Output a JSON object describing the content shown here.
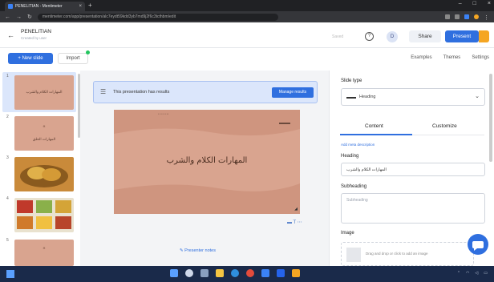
{
  "browser": {
    "tab_title": "PENELITIAN - Mentimeter",
    "url": "mentimeter.com/app/presentation/alc7eydt59kdd3yb7md9j2f6c3tcthbm/edit"
  },
  "header": {
    "title": "PENELITIAN",
    "subtitle": "Created by user",
    "saved_label": "Saved",
    "help_icon": "question-icon",
    "avatar_initials": "D",
    "share_label": "Share",
    "present_label": "Present"
  },
  "toolbar": {
    "new_slide_label": "+ New slide",
    "import_label": "Import",
    "examples_label": "Examples",
    "themes_label": "Themes",
    "settings_label": "Settings"
  },
  "thumbnails": [
    {
      "number": "1",
      "label": "المهارات الكلام والشرب",
      "bg": "#d9a48f"
    },
    {
      "number": "2",
      "label": "المهارات الحلق",
      "bg": "#d9a48f"
    },
    {
      "number": "3",
      "label": "",
      "bg": "#c98a3a"
    },
    {
      "number": "4",
      "label": "",
      "bg": "#e9e2cf"
    },
    {
      "number": "5",
      "label": "",
      "bg": "#d9a48f"
    }
  ],
  "banner": {
    "text": "This presentation has results",
    "button_label": "Manage results"
  },
  "slide": {
    "title": "المهارات الكلام والشرب"
  },
  "presenter_notes_label": "Presenter notes",
  "panel": {
    "slide_type_label": "Slide type",
    "slide_type_value": "Heading",
    "tab_content": "Content",
    "tab_customize": "Customize",
    "add_description": "Add meta description",
    "heading_label": "Heading",
    "heading_value": "المهارات الكلام والشرب",
    "subheading_label": "Subheading",
    "subheading_placeholder": "Subheading",
    "image_label": "Image",
    "image_drop_text": "Drag and drop or click to add an image"
  },
  "colors": {
    "accent": "#2f6fdf",
    "slide_bg": "#d9a48f",
    "taskbar": "#1a2a4a"
  }
}
